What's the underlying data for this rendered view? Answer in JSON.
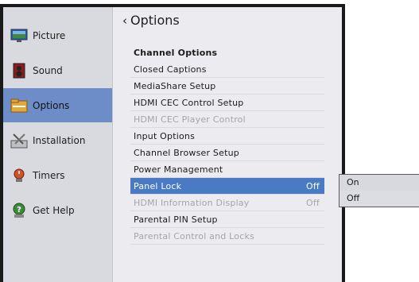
{
  "sidebar": {
    "items": [
      {
        "label": "Picture",
        "icon": "monitor-icon"
      },
      {
        "label": "Sound",
        "icon": "speaker-icon"
      },
      {
        "label": "Options",
        "icon": "options-folder-icon",
        "selected": true
      },
      {
        "label": "Installation",
        "icon": "tools-icon"
      },
      {
        "label": "Timers",
        "icon": "timer-icon"
      },
      {
        "label": "Get Help",
        "icon": "help-icon"
      }
    ]
  },
  "main": {
    "heading": "Options",
    "back_glyph": "‹",
    "items": [
      {
        "label": "Channel Options",
        "value": "",
        "state": "section"
      },
      {
        "label": "Closed Captions",
        "value": "",
        "state": "normal"
      },
      {
        "label": "MediaShare Setup",
        "value": "",
        "state": "normal"
      },
      {
        "label": "HDMI CEC Control Setup",
        "value": "",
        "state": "normal"
      },
      {
        "label": "HDMI CEC Player Control",
        "value": "",
        "state": "disabled"
      },
      {
        "label": "Input Options",
        "value": "",
        "state": "normal"
      },
      {
        "label": "Channel Browser Setup",
        "value": "",
        "state": "normal"
      },
      {
        "label": "Power Management",
        "value": "",
        "state": "normal"
      },
      {
        "label": "Panel Lock",
        "value": "Off",
        "state": "selected"
      },
      {
        "label": "HDMI Information Display",
        "value": "Off",
        "state": "disabled"
      },
      {
        "label": "Parental PIN Setup",
        "value": "",
        "state": "normal"
      },
      {
        "label": "Parental Control and Locks",
        "value": "",
        "state": "disabled"
      }
    ]
  },
  "popup": {
    "options": [
      "On",
      "Off"
    ]
  },
  "colors": {
    "accent": "#4a7ac4",
    "sidebar_selected": "#6c8dc7"
  }
}
